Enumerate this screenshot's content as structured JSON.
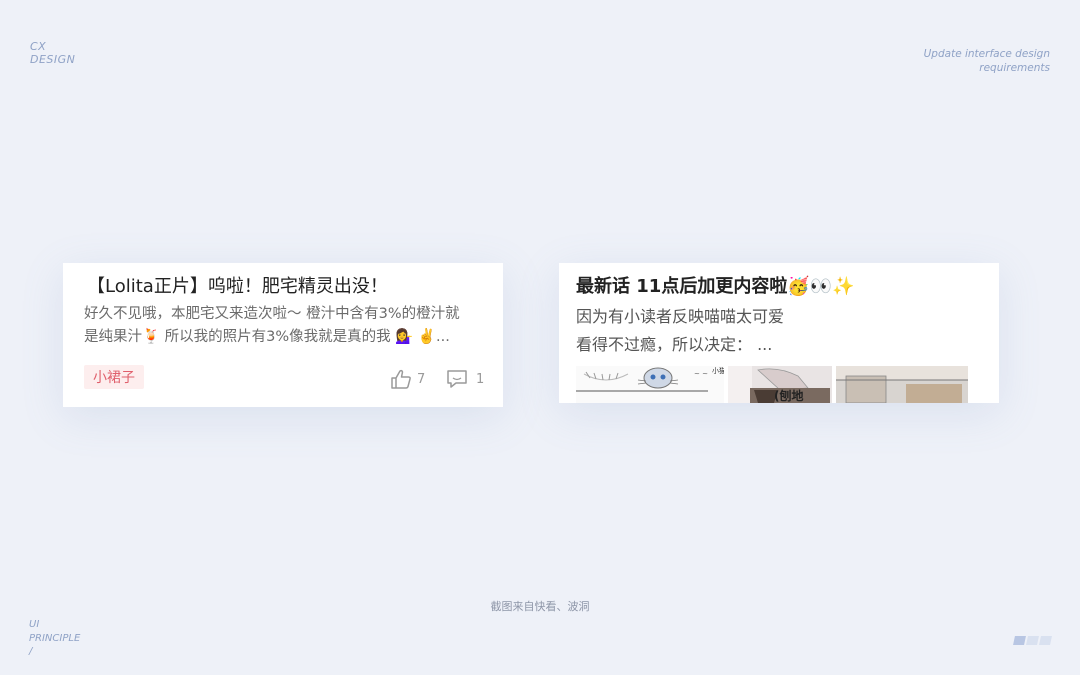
{
  "brand": {
    "line1": "CX",
    "line2": "DESIGN"
  },
  "header_note": {
    "line1": "Update interface design",
    "line2": "requirements"
  },
  "footer_label": {
    "line1": "UI",
    "line2": "PRINCIPLE",
    "line3": "/"
  },
  "caption": "截图来自快看、波洞",
  "colors": {
    "background": "#eef1f8",
    "accent_text": "#8fa2c6",
    "tag_bg": "#fdeeee",
    "tag_text": "#e0606c"
  },
  "card1": {
    "title": "【Lolita正片】呜啦！肥宅精灵出没！",
    "desc_line1": "好久不见哦，本肥宅又来造次啦～ 橙汁中含有3%的橙汁就",
    "desc_line2": "是纯果汁🍹 所以我的照片有3%像我就是真的我 💁‍♀️ ✌️...",
    "tag": "小裙子",
    "likes": "7",
    "comments": "1",
    "like_icon": "thumbs-up-icon",
    "comment_icon": "comment-icon"
  },
  "card2": {
    "title": "最新话 11点后加更内容啦🥳👀✨",
    "desc_line1": "因为有小读者反映喵喵太可爱",
    "desc_line2": "看得不过瘾，所以决定： ...",
    "thumb_texts": [
      "小猫咪！",
      "(刨地"
    ]
  },
  "pager": {
    "active_color": "#b8c6e3",
    "inactive_color": "#d9e1f0"
  }
}
